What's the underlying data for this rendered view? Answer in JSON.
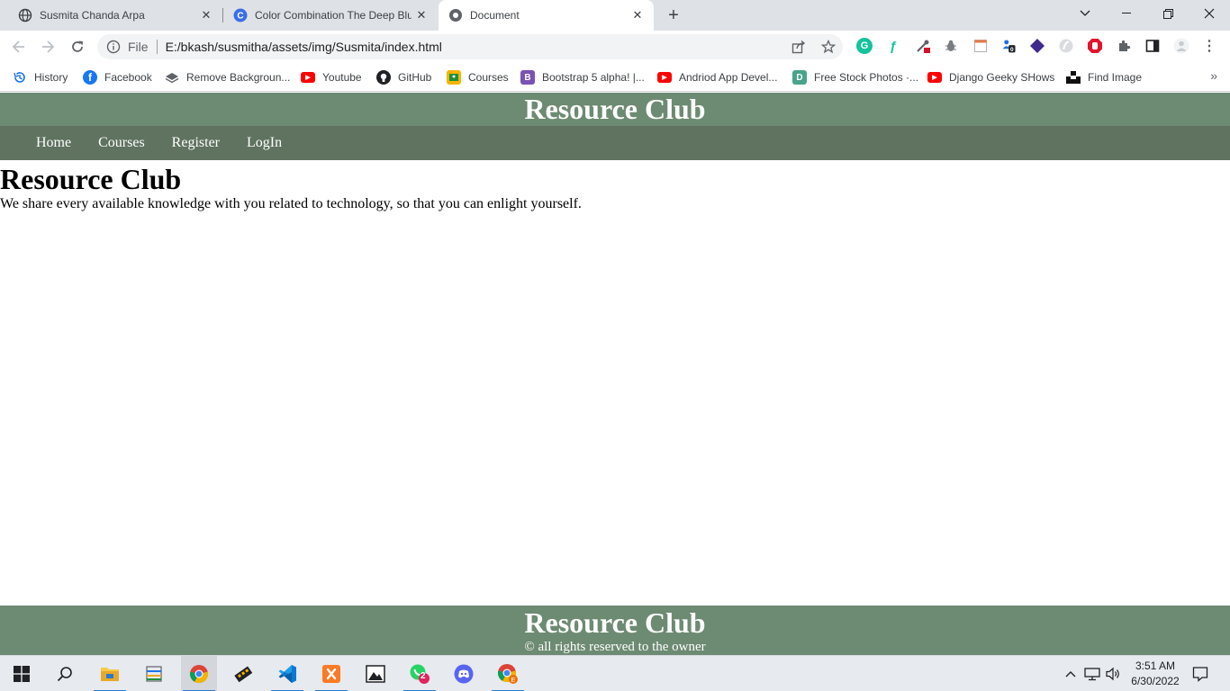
{
  "browser": {
    "tabs": [
      {
        "title": "Susmita Chanda Arpa",
        "icon": "globe-icon"
      },
      {
        "title": "Color Combination The Deep Blu",
        "icon": "c-logo-icon"
      },
      {
        "title": "Document",
        "icon": "globe-icon"
      }
    ],
    "address": {
      "scheme": "File",
      "url": "E:/bkash/susmitha/assets/img/Susmita/index.html"
    },
    "bookmarks": [
      {
        "label": "History",
        "icon": "history-icon",
        "color": "#1a73e8"
      },
      {
        "label": "Facebook",
        "icon": "facebook-icon",
        "color": "#1877f2"
      },
      {
        "label": "Remove Backgroun...",
        "icon": "layers-icon",
        "color": "#5f6368"
      },
      {
        "label": "Youtube",
        "icon": "youtube-icon",
        "color": "#ff0000"
      },
      {
        "label": "GitHub",
        "icon": "github-icon",
        "color": "#202124"
      },
      {
        "label": "Courses",
        "icon": "classroom-icon",
        "color": "#f5b400"
      },
      {
        "label": "Bootstrap 5 alpha! |...",
        "icon": "bootstrap-icon",
        "color": "#7952b3"
      },
      {
        "label": "Andriod App Devel...",
        "icon": "youtube-icon",
        "color": "#ff0000"
      },
      {
        "label": "Free Stock Photos ·...",
        "icon": "d-logo-icon",
        "color": "#4aa38a"
      },
      {
        "label": "Django Geeky SHows",
        "icon": "youtube-icon",
        "color": "#ff0000"
      },
      {
        "label": "Find Image",
        "icon": "unsplash-icon",
        "color": "#111111"
      }
    ]
  },
  "site": {
    "header_title": "Resource Club",
    "nav": [
      "Home",
      "Courses",
      "Register",
      "LogIn"
    ],
    "heading": "Resource Club",
    "intro": "We share every available knowledge with you related to technology, so that you can enlight yourself.",
    "footer_title": "Resource Club",
    "footer_copy": "© all rights reserved to the owner",
    "colors": {
      "header": "#6d8a72",
      "nav": "#5f7360"
    }
  },
  "taskbar": {
    "time": "3:51 AM",
    "date": "6/30/2022",
    "whatsapp_badge": "2"
  }
}
